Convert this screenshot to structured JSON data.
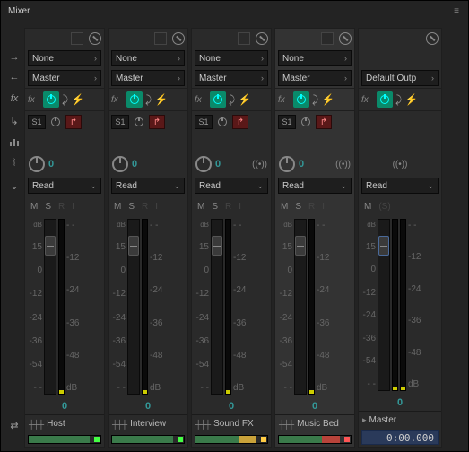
{
  "title": "Mixer",
  "routing": {
    "none": "None",
    "master": "Master",
    "default_out": "Default Outp"
  },
  "fx_label": "fx",
  "send_label": "S1",
  "pan_value": "0",
  "automation": "Read",
  "solo_labels": {
    "m": "M",
    "s": "S",
    "r": "R",
    "i": "I",
    "ms": "(S)"
  },
  "db_label": "dB",
  "scale_left": [
    "15",
    "0",
    "-12",
    "-24",
    "-36",
    "-54",
    "- -"
  ],
  "scale_right": [
    "- -",
    "-12",
    "-24",
    "-36",
    "-48",
    "dB"
  ],
  "vol_value": "0",
  "tracks": [
    {
      "name": "Host",
      "color1": "#3a7a4a",
      "color2": "#3a7a4a",
      "sq": "#4f4"
    },
    {
      "name": "Interview",
      "color1": "#3a7a4a",
      "color2": "#3a7a4a",
      "sq": "#4f4"
    },
    {
      "name": "Sound FX",
      "color1": "#3a7a4a",
      "color2": "#c9a23a",
      "sq": "#fc4"
    },
    {
      "name": "Music Bed",
      "color1": "#3a7a4a",
      "color2": "#b8433a",
      "sq": "#f55"
    }
  ],
  "master": {
    "name": "Master"
  },
  "timecode": "0:00.000"
}
